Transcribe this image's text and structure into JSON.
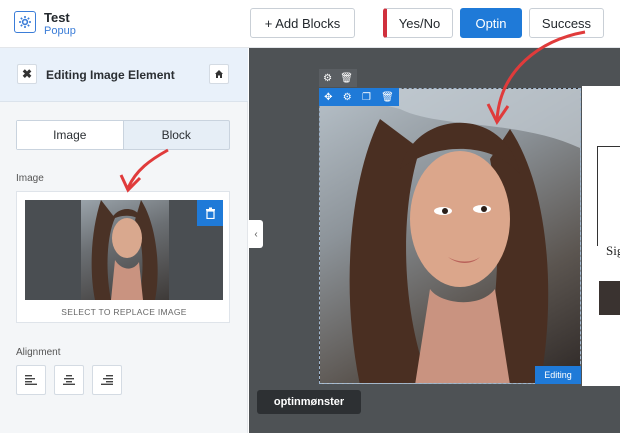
{
  "header": {
    "title": "Test",
    "subtitle": "Popup",
    "add_blocks_label": "+ Add Blocks",
    "views": [
      {
        "label": "Yes/No"
      },
      {
        "label": "Optin"
      },
      {
        "label": "Success"
      }
    ]
  },
  "sidebar": {
    "panel_title": "Editing Image Element",
    "tabs": [
      {
        "label": "Image"
      },
      {
        "label": "Block"
      }
    ],
    "image_label": "Image",
    "replace_text": "SELECT TO REPLACE IMAGE",
    "alignment_label": "Alignment"
  },
  "canvas": {
    "editing_badge": "Editing",
    "logo_text": "optinmønster",
    "popup_partial_text": "Sig"
  },
  "colors": {
    "accent": "#1f7ad8",
    "yesno_marker": "#d0303d",
    "canvas_bg": "#4e5255"
  }
}
